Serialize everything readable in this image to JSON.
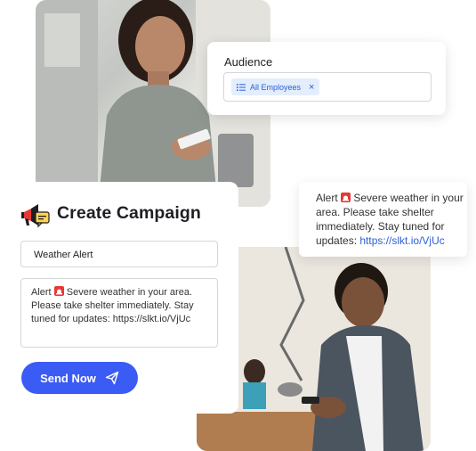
{
  "audience": {
    "title": "Audience",
    "chip_label": "All Employees",
    "chip_remove": "×"
  },
  "campaign": {
    "title": "Create Campaign",
    "name_value": "Weather Alert",
    "message_prefix": "Alert ",
    "message_body": " Severe weather in your area. Please take shelter immediately. Stay tuned for updates: https://slkt.io/VjUc",
    "send_label": "Send Now"
  },
  "notification": {
    "prefix": "Alert ",
    "body": " Severe weather in your area. Please take shelter immediately. Stay tuned for updates: ",
    "link": "https://slkt.io/VjUc"
  },
  "colors": {
    "accent": "#3b5bf5",
    "chip_bg": "#e3edfc",
    "link": "#2b5fd9",
    "siren": "#e53935"
  },
  "icons": [
    "list-icon",
    "close-icon",
    "megaphone-chat-icon",
    "send-plane-icon",
    "siren-icon"
  ]
}
